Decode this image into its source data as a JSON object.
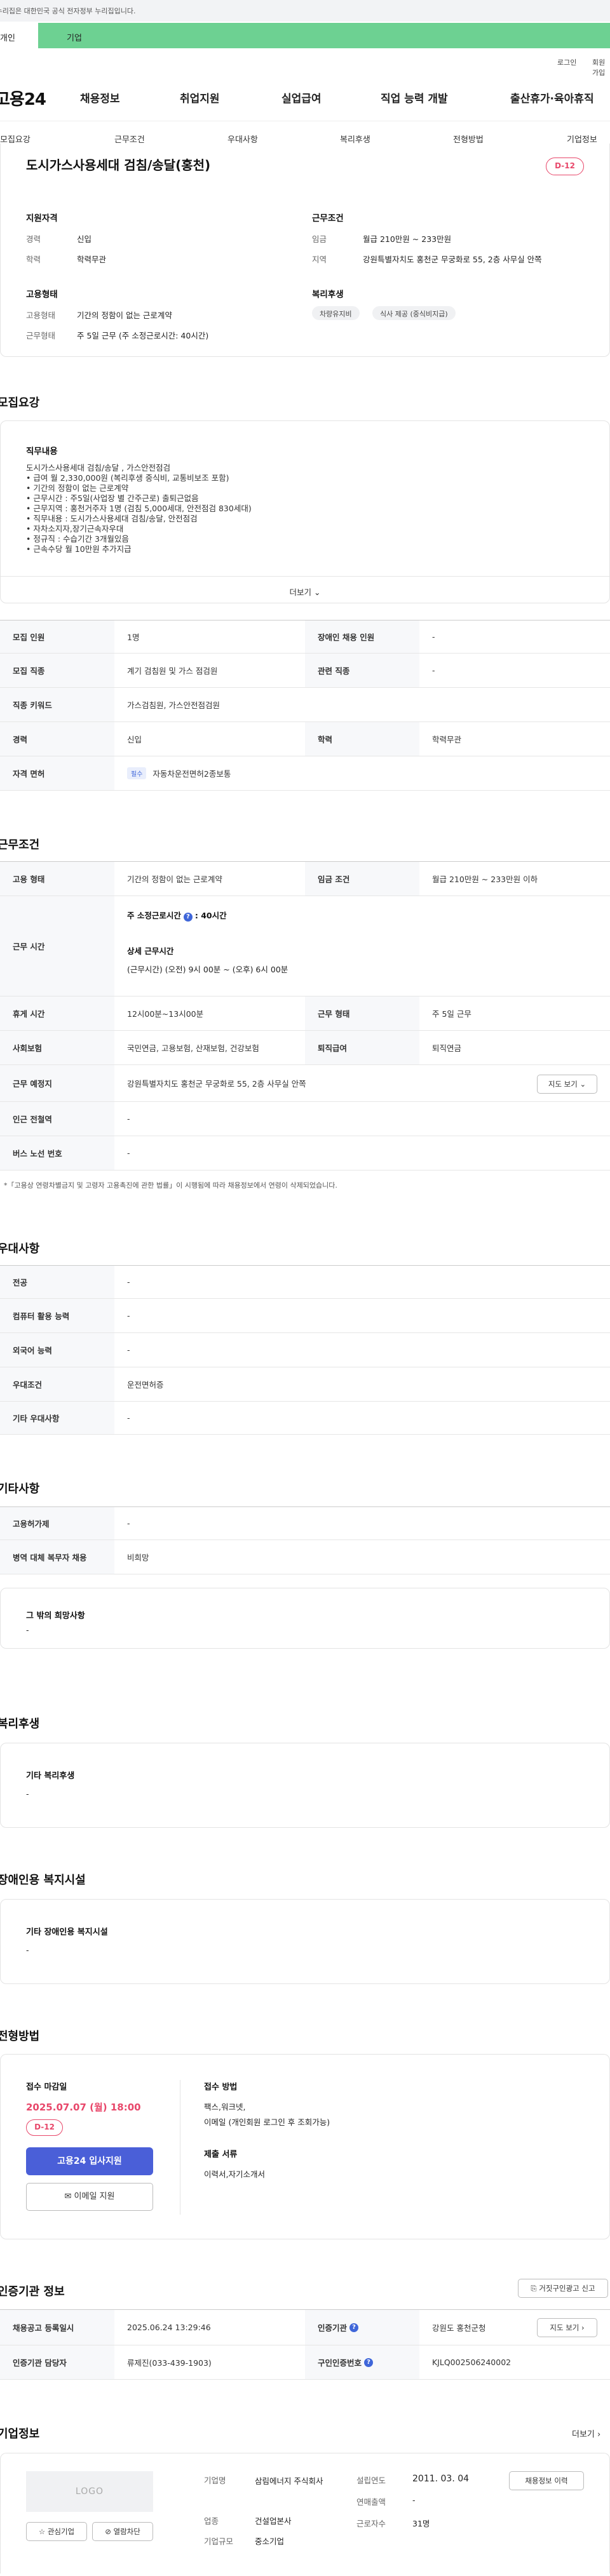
{
  "gov_banner": "이 누리집은 대한민국 공식 전자정부 누리집입니다.",
  "top_tabs": {
    "left": "개인",
    "right": "기업"
  },
  "util": {
    "login": "로그인",
    "signup": "회원가입"
  },
  "logo": "고용24",
  "gnb": [
    "채용정보",
    "취업지원",
    "실업급여",
    "직업 능력 개발",
    "출산휴가·육아휴직"
  ],
  "subnav": [
    "모집요강",
    "근무조건",
    "우대사항",
    "복리후생",
    "전형방법",
    "기업정보"
  ],
  "job": {
    "title": "도시가스사용세대 검침/송달(홍천)",
    "dday": "D-12",
    "qual_title": "지원자격",
    "career_label": "경력",
    "career": "신입",
    "edu_label": "학력",
    "edu": "학력무관",
    "employ_title": "고용형태",
    "emptype_label": "고용형태",
    "emptype": "기간의 정함이 없는 근로계약",
    "worktype_label": "근무형태",
    "worktype": "주 5일 근무 (주 소정근로시간: 40시간)",
    "cond_title": "근무조건",
    "wage_label": "임금",
    "wage": "월급 210만원 ~ 233만원",
    "area_label": "지역",
    "area": "강원특별자치도 홍천군 무궁화로 55, 2층 사무실 안쪽",
    "welfare_title": "복리후생",
    "welfare_chips": [
      "차량유지비",
      "식사 제공 (중식비지급)"
    ]
  },
  "recruit": {
    "section_title": "모집요강",
    "duty_title": "직무내용",
    "duty_lines": [
      "도시가스사용세대 검침/송달 , 가스안전점검",
      "• 급여 월 2,330,000원 (복리후생 중식비, 교통비보조  포함)",
      "• 기간의 정함이 없는 근로계약",
      "• 근무시간 : 주5일(사업장 별 간주근로) 출퇴근없음",
      "• 근무지역 : 홍천거주자 1명 (검침 5,000세대, 안전점검 830세대)",
      "• 직무내용 : 도시가스사용세대 검침/송달, 안전점검",
      "• 자차소지자,장기근속자우대",
      "• 정규직 : 수습기간 3개월있음",
      "• 근속수당 월 10만원 추가지급"
    ],
    "more": "더보기",
    "rows": {
      "count_label": "모집 인원",
      "count": "1명",
      "disabled_label": "장애인 채용 인원",
      "disabled": "-",
      "job_label": "모집 직종",
      "job": "계기 검침원 및 가스 점검원",
      "related_label": "관련 직종",
      "related": "-",
      "keyword_label": "직종 키워드",
      "keyword": "가스검침원, 가스안전점검원",
      "career_label": "경력",
      "career": "신입",
      "edu_label": "학력",
      "edu": "학력무관",
      "license_label": "자격 면허",
      "license_badge": "필수",
      "license": "자동차운전면허2종보통"
    }
  },
  "work": {
    "section_title": "근무조건",
    "emptype_label": "고용 형태",
    "emptype": "기간의 정함이 없는 근로계약",
    "wage_label": "임금 조건",
    "wage": "월급 210만원 ~ 233만원 이하",
    "time_label": "근무 시간",
    "weekly_label": "주 소정근로시간",
    "weekly": ": 40시간",
    "detail_label": "상세 근무시간",
    "detail": "(근무시간) (오전) 9시 00분 ~ (오후) 6시 00분",
    "break_label": "휴게 시간",
    "break": "12시00분~13시00분",
    "form_label": "근무 형태",
    "form": "주 5일 근무",
    "insure_label": "사회보험",
    "insure": "국민연금, 고용보험, 산재보험, 건강보험",
    "retire_label": "퇴직급여",
    "retire": "퇴직연금",
    "place_label": "근무 예정지",
    "place": "강원특별자치도 홍천군 무궁화로 55, 2층 사무실 안쪽",
    "map_btn": "지도 보기",
    "subway_label": "인근 전철역",
    "subway": "-",
    "bus_label": "버스 노선 번호",
    "bus": "-",
    "note": "*「고용상 연령차별금지 및 고령자 고용촉진에 관한 법률」이 시행됨에 따라 채용정보에서 연령이 삭제되었습니다."
  },
  "pref": {
    "section_title": "우대사항",
    "major_label": "전공",
    "major": "-",
    "pc_label": "컴퓨터 활용 능력",
    "pc": "-",
    "lang_label": "외국어 능력",
    "lang": "-",
    "cond_label": "우대조건",
    "cond": "운전면허증",
    "etc_label": "기타 우대사항",
    "etc": "-"
  },
  "other": {
    "section_title": "기타사항",
    "emp_label": "고용허가제",
    "emp": "-",
    "mil_label": "병역 대체 복무자 채용",
    "mil": "비희망",
    "box_title": "그 밖의 희망사항",
    "box_val": "-"
  },
  "welfare": {
    "section_title": "복리후생",
    "box_title": "기타 복리후생",
    "box_val": "-"
  },
  "facility": {
    "section_title": "장애인용 복지시설",
    "box_title": "기타 장애인용 복지시설",
    "box_val": "-"
  },
  "apply": {
    "section_title": "전형방법",
    "deadline_label": "접수 마감일",
    "deadline": "2025.07.07 (월) 18:00",
    "dday": "D-12",
    "apply_btn": "고용24 입사지원",
    "email_btn": "이메일 지원",
    "method_label": "접수 방법",
    "method1": "팩스,워크넷,",
    "method2": "이메일 (개인회원 로그인 후 조회가능)",
    "docs_label": "제출 서류",
    "docs": "이력서,자기소개서"
  },
  "cert": {
    "section_title": "인증기관 정보",
    "report_btn": "거짓구인광고 신고",
    "reg_label": "채용공고 등록일시",
    "reg": "2025.06.24 13:29:46",
    "org_label": "인증기관",
    "org": "강원도 홍천군청",
    "map_btn": "지도 보기",
    "mgr_label": "인증기관 담당자",
    "mgr": "류제진(033-439-1903)",
    "no_label": "구인인증번호",
    "no": "KJLQ002506240002"
  },
  "company": {
    "section_title": "기업정보",
    "more": "더보기",
    "logo": "LOGO",
    "fav_btn": "관심기업",
    "block_btn": "열람차단",
    "name_label": "기업명",
    "name": "삼림에너지 주식회사",
    "industry_label": "업종",
    "industry": "건설업본사",
    "scale_label": "기업규모",
    "scale": "중소기업",
    "founded_label": "설립연도",
    "founded": "2011. 03. 04",
    "sales_label": "연매출액",
    "sales": "-",
    "staff_label": "근로자수",
    "staff": "31명",
    "jobs_btn": "채용정보 이력"
  }
}
